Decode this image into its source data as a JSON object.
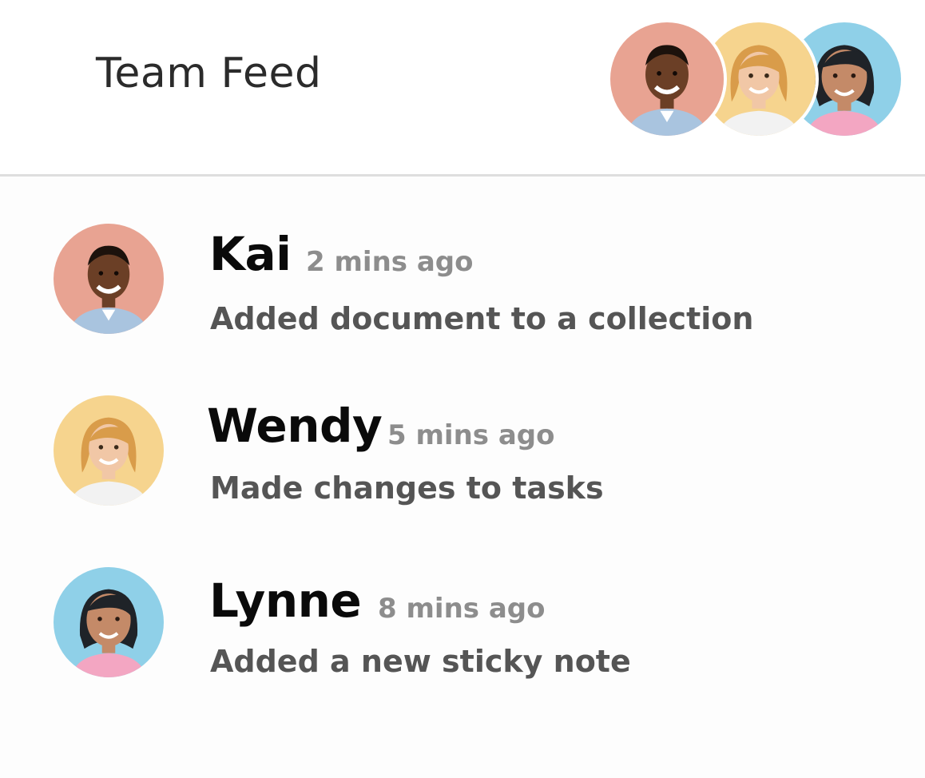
{
  "header": {
    "title": "Team Feed"
  },
  "feed": [
    {
      "name": "Kai",
      "time": "2 mins ago",
      "action": "Added document to a collection",
      "avatar_bg": "#e8a392"
    },
    {
      "name": "Wendy",
      "time": "5 mins ago",
      "action": "Made changes to tasks",
      "avatar_bg": "#f6d48e"
    },
    {
      "name": "Lynne",
      "time": "8 mins ago",
      "action": "Added a new sticky note",
      "avatar_bg": "#8fd0e8"
    }
  ]
}
